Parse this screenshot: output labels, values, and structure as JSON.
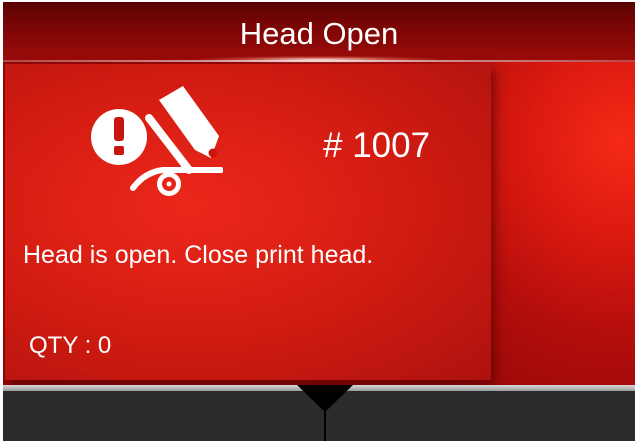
{
  "window": {
    "title": "Head Open"
  },
  "error": {
    "icon": "head-open-warning-icon",
    "code": "# 1007",
    "message": "Head is open. Close print head.",
    "qty_label": "QTY : 0"
  },
  "colors": {
    "panel_red": "#d41c12",
    "title_bar": "#7e0606",
    "bottom_bar": "#2b2b2b",
    "text": "#ffffff"
  }
}
